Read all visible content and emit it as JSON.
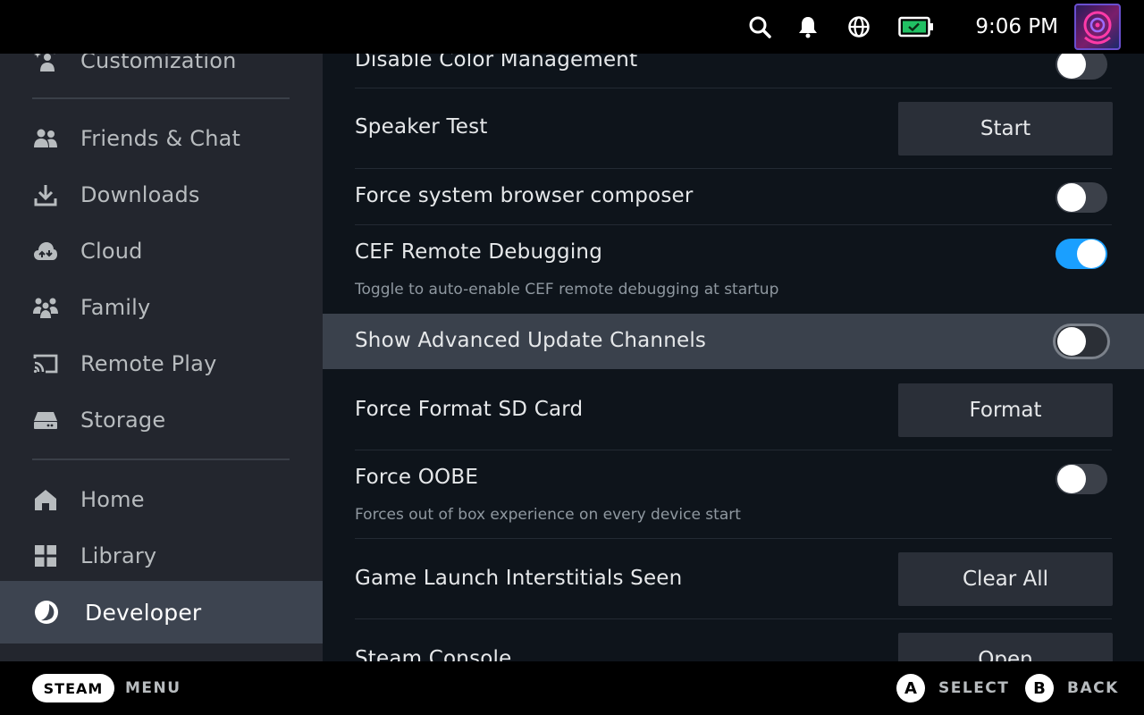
{
  "topbar": {
    "time": "9:06 PM",
    "icons": [
      "search-icon",
      "bell-icon",
      "globe-icon",
      "battery-icon"
    ],
    "battery_color": "#21c063"
  },
  "sidebar": {
    "items": [
      {
        "label": "Customization",
        "icon": "sparkle-person-icon"
      },
      {
        "label": "Friends & Chat",
        "icon": "friends-icon"
      },
      {
        "label": "Downloads",
        "icon": "download-icon"
      },
      {
        "label": "Cloud",
        "icon": "cloud-icon"
      },
      {
        "label": "Family",
        "icon": "family-icon"
      },
      {
        "label": "Remote Play",
        "icon": "cast-icon"
      },
      {
        "label": "Storage",
        "icon": "drive-icon"
      },
      {
        "label": "Home",
        "icon": "home-icon"
      },
      {
        "label": "Library",
        "icon": "grid-icon"
      },
      {
        "label": "Developer",
        "icon": "developer-icon",
        "active": true
      }
    ]
  },
  "settings": [
    {
      "label": "Disable Color Management",
      "control": "toggle",
      "value": "off"
    },
    {
      "label": "Speaker Test",
      "control": "button",
      "button_label": "Start"
    },
    {
      "label": "Force system browser composer",
      "control": "toggle",
      "value": "off"
    },
    {
      "label": "CEF Remote Debugging",
      "control": "toggle",
      "value": "on",
      "description": "Toggle to auto-enable CEF remote debugging at startup"
    },
    {
      "label": "Show Advanced Update Channels",
      "control": "toggle",
      "value": "off",
      "focused": true
    },
    {
      "label": "Force Format SD Card",
      "control": "button",
      "button_label": "Format"
    },
    {
      "label": "Force OOBE",
      "control": "toggle",
      "value": "off",
      "description": "Forces out of box experience on every device start"
    },
    {
      "label": "Game Launch Interstitials Seen",
      "control": "button",
      "button_label": "Clear All"
    },
    {
      "label": "Steam Console",
      "control": "button",
      "button_label": "Open"
    }
  ],
  "bottombar": {
    "steam_label": "STEAM",
    "menu_label": "MENU",
    "a_button": "A",
    "select_label": "SELECT",
    "b_button": "B",
    "back_label": "BACK"
  },
  "colors": {
    "accent": "#1a9fff",
    "sidebar_bg": "#23262e",
    "main_bg": "#0e141b",
    "highlight_bg": "#3a414c"
  }
}
